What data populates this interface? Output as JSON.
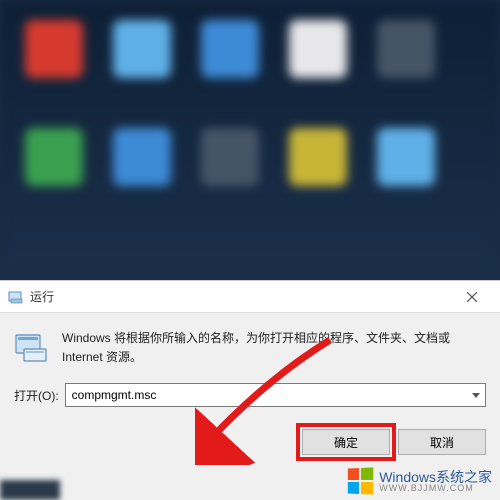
{
  "dialog": {
    "title": "运行",
    "description": "Windows 将根据你所输入的名称，为你打开相应的程序、文件夹、文档或 Internet 资源。",
    "open_label": "打开(O):",
    "input_value": "compmgmt.msc",
    "ok_label": "确定",
    "cancel_label": "取消"
  },
  "watermark": {
    "main": "Windows系统之家",
    "sub": "WWW.BJJMW.COM"
  },
  "colors": {
    "highlight": "#e21a1a",
    "dialog_bg": "#f0f0f0"
  }
}
